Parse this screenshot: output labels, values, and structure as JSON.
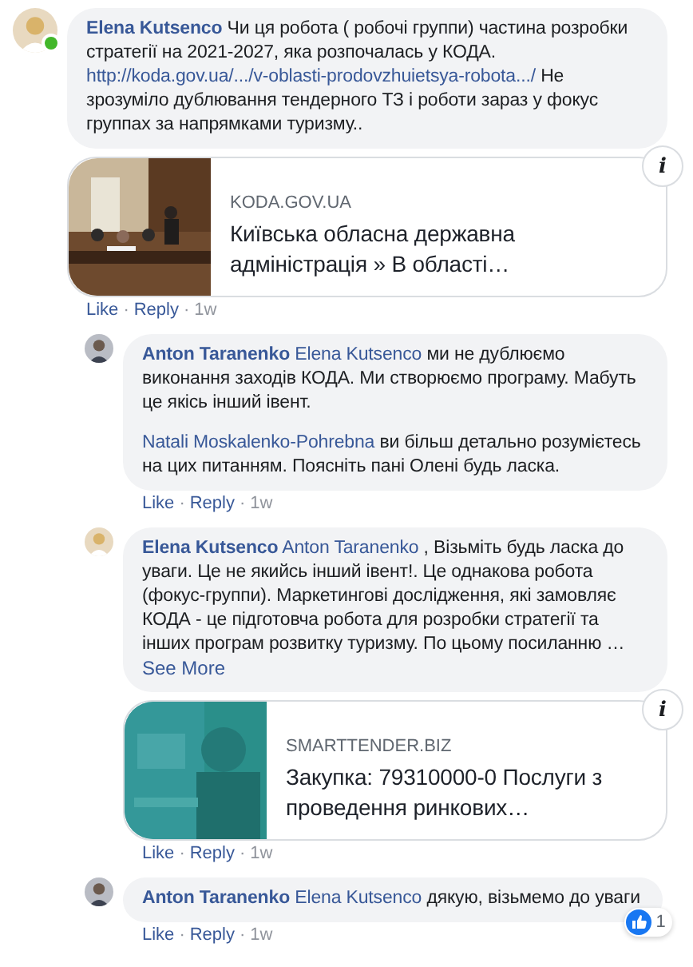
{
  "comments": [
    {
      "author": "Elena Kutsenco",
      "online": true,
      "paragraphs": [
        [
          {
            "kind": "text",
            "text": "Чи ця робота ( робочі группи) частина розробки стратегії на 2021-2027, яка розпочалась у КОДА. "
          },
          {
            "kind": "link",
            "text": "http://koda.gov.ua/.../v-oblasti-prodovzhuietsya-robota.../"
          },
          {
            "kind": "text",
            "text": " Не зрозуміло дублювання тендерного ТЗ і роботи зараз у фокус группах за напрямками туризму.."
          }
        ]
      ],
      "preview": {
        "domain": "KODA.GOV.UA",
        "title": "Київська обласна державна адміністрація » В області…",
        "info": "i"
      },
      "actions": [
        {
          "kind": "like",
          "text": "Like"
        },
        {
          "kind": "separator",
          "text": "·"
        },
        {
          "kind": "reply",
          "text": "Reply"
        },
        {
          "kind": "separator",
          "text": "·"
        },
        {
          "kind": "time",
          "text": "1w"
        }
      ],
      "replies": [
        {
          "author": "Anton Taranenko",
          "paragraphs": [
            [
              {
                "kind": "mention",
                "text": "Elena Kutsenco"
              },
              {
                "kind": "text",
                "text": " ми не дублюємо виконання заходів КОДА. Ми створюємо програму. Мабуть це якісь інший івент."
              }
            ],
            [
              {
                "kind": "mention",
                "text": "Natali Moskalenko-Pohrebna"
              },
              {
                "kind": "text",
                "text": " ви більш детально розумієтесь на цих питанням. Поясніть пані Олені будь ласка."
              }
            ]
          ],
          "actions": [
            {
              "kind": "like",
              "text": "Like"
            },
            {
              "kind": "separator",
              "text": "·"
            },
            {
              "kind": "reply",
              "text": "Reply"
            },
            {
              "kind": "separator",
              "text": "·"
            },
            {
              "kind": "time",
              "text": "1w"
            }
          ]
        },
        {
          "author": "Elena Kutsenco",
          "paragraphs": [
            [
              {
                "kind": "mention",
                "text": "Anton Taranenko"
              },
              {
                "kind": "text",
                "text": " , Візьміть будь ласка до уваги. Це не якийсь інший івент!. Це однакова робота (фокус-группи). Маркетингові дослідження, які замовляє КОДА - це підготовча робота для розробки стратегії та інших програм розвитку туризму. По цьому посиланню …"
              }
            ]
          ],
          "see_more": "See More",
          "preview": {
            "domain": "SMARTTENDER.BIZ",
            "title": "Закупка: 79310000-0 Послуги з проведення ринкових…",
            "info": "i"
          },
          "actions": [
            {
              "kind": "like",
              "text": "Like"
            },
            {
              "kind": "separator",
              "text": "·"
            },
            {
              "kind": "reply",
              "text": "Reply"
            },
            {
              "kind": "separator",
              "text": "·"
            },
            {
              "kind": "time",
              "text": "1w"
            }
          ]
        },
        {
          "author": "Anton Taranenko",
          "paragraphs": [
            [
              {
                "kind": "mention",
                "text": "Elena Kutsenco"
              },
              {
                "kind": "text",
                "text": " дякую, візьмемо до уваги"
              }
            ]
          ],
          "reactions": {
            "count": "1"
          },
          "actions": [
            {
              "kind": "like",
              "text": "Like"
            },
            {
              "kind": "separator",
              "text": "·"
            },
            {
              "kind": "reply",
              "text": "Reply"
            },
            {
              "kind": "separator",
              "text": "·"
            },
            {
              "kind": "time",
              "text": "1w"
            }
          ]
        }
      ]
    }
  ]
}
